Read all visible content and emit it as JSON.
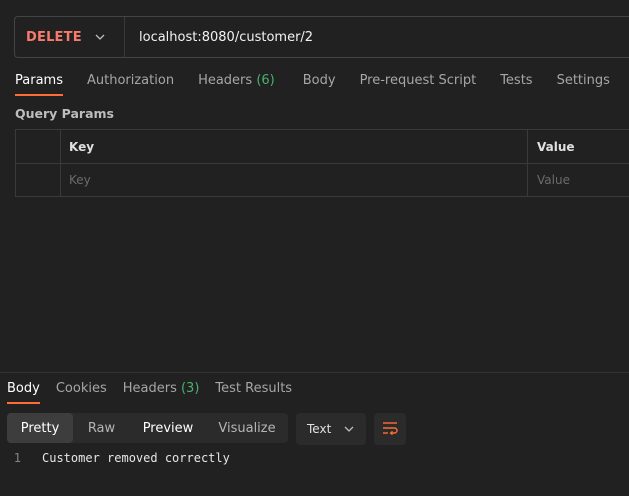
{
  "colors": {
    "method": "#f77b6d",
    "accent": "#ff6c37",
    "count": "#4caf70"
  },
  "request": {
    "method": "DELETE",
    "url": "localhost:8080/customer/2",
    "tabs": [
      {
        "label": "Params"
      },
      {
        "label": "Authorization"
      },
      {
        "label": "Headers",
        "count": "(6)"
      },
      {
        "label": "Body"
      },
      {
        "label": "Pre-request Script"
      },
      {
        "label": "Tests"
      },
      {
        "label": "Settings"
      }
    ],
    "query_params_title": "Query Params",
    "table": {
      "headers": {
        "key": "Key",
        "value": "Value"
      },
      "placeholders": {
        "key": "Key",
        "value": "Value"
      }
    }
  },
  "response": {
    "tabs": [
      {
        "label": "Body"
      },
      {
        "label": "Cookies"
      },
      {
        "label": "Headers",
        "count": "(3)"
      },
      {
        "label": "Test Results"
      }
    ],
    "views": [
      "Pretty",
      "Raw",
      "Preview",
      "Visualize"
    ],
    "format": "Text",
    "lines": [
      {
        "number": "1",
        "text": "Customer removed correctly"
      }
    ]
  },
  "icons": {
    "method_dropdown": "chevron-down-icon",
    "format_dropdown": "chevron-down-icon",
    "wrap": "wrap-lines-icon"
  }
}
